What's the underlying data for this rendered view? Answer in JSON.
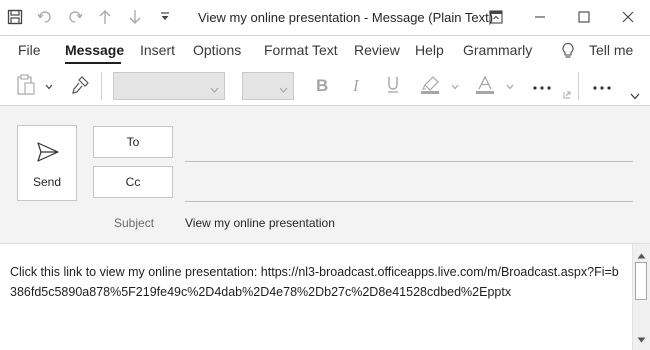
{
  "window": {
    "title": "View my online presentation  -  Message (Plain Text)"
  },
  "qat": {
    "icons": [
      "save-icon",
      "undo-icon",
      "redo-icon",
      "up-arrow-icon",
      "down-arrow-icon",
      "customize-dropdown-icon"
    ]
  },
  "tabs": [
    {
      "label": "File"
    },
    {
      "label": "Message"
    },
    {
      "label": "Insert"
    },
    {
      "label": "Options"
    },
    {
      "label": "Format Text"
    },
    {
      "label": "Review"
    },
    {
      "label": "Help"
    },
    {
      "label": "Grammarly"
    },
    {
      "label": "Tell me"
    }
  ],
  "active_tab": "Message",
  "compose": {
    "send_label": "Send",
    "to_label": "To",
    "cc_label": "Cc",
    "subject_label": "Subject",
    "subject_value": "View my online presentation",
    "to_value": "",
    "cc_value": ""
  },
  "body": {
    "text": "Click this link to view my online presentation: https://nl3-broadcast.officeapps.live.com/m/Broadcast.aspx?Fi=b386fd5c5890a878%5F219fe49c%2D4dab%2D4e78%2Db27c%2D8e41528cdbed%2Epptx"
  },
  "colors": {
    "accent_underline": "#1f1f1f",
    "compose_background": "#f3f3f3",
    "disabled_icon": "#a6a6a6"
  }
}
